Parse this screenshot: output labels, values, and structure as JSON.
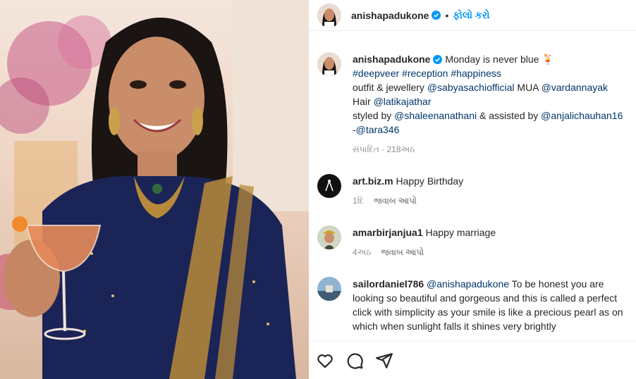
{
  "post": {
    "image_alt": "Woman in navy blue saree holding a cocktail glass",
    "author": "anishapadukone",
    "follow_label": "ફોલો કરો",
    "separator": "•"
  },
  "caption": {
    "username": "anishapadukone",
    "text": " Monday is never blue 🍹",
    "hashtags": "#deepveer #reception #happiness",
    "line3_prefix": "outfit & jewellery ",
    "line3_link1": "@sabyasachiofficial",
    "line3_mid": " MUA ",
    "line3_link2": "@vardannayak",
    "line4_prefix": "Hair ",
    "line4_link": "@latikajathar",
    "line5_prefix": "styled by ",
    "line5_link1": "@shaleenanathani",
    "line5_mid": " & assisted by ",
    "line5_link2": "@anjalichauhan16",
    "line6_prefix": "-",
    "line6_link": "@tara346",
    "meta": "સંપાદિત · 218અઠ"
  },
  "comments": [
    {
      "username": "art.biz.m",
      "text": " Happy Birthday",
      "time": "1દિ",
      "reply": "જવાબ આપો"
    },
    {
      "username": "amarbirjanjua1",
      "text": " Happy marriage",
      "time": "4અઠ",
      "reply": "જવાબ આપો"
    },
    {
      "username": "sailordaniel786",
      "mention": " @anishapadukone",
      "line1_rest": " To be honest you are",
      "line2": "looking so beautiful and gorgeous and this is called a perfect",
      "line3": "click with simplicity as your smile is like a precious pearl as on",
      "line4": "which when sunlight falls it shines very brightly"
    }
  ],
  "actions": {
    "like_icon": "heart-icon",
    "comment_icon": "comment-icon",
    "share_icon": "share-icon"
  },
  "colors": {
    "link": "#00376b",
    "follow": "#0095f6",
    "verified": "#0095f6",
    "saree": "#1b2456",
    "gold": "#b8893a"
  }
}
